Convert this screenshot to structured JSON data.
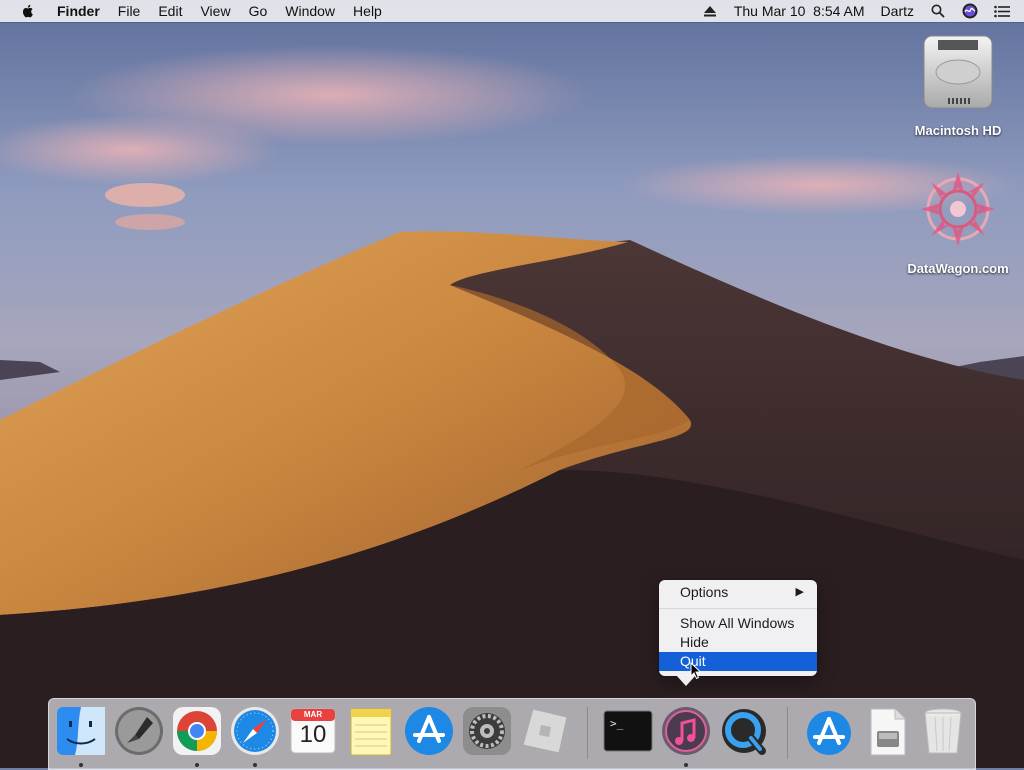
{
  "menubar": {
    "apple_icon": "apple-logo",
    "app_name": "Finder",
    "menus": [
      "File",
      "Edit",
      "View",
      "Go",
      "Window",
      "Help"
    ],
    "status": {
      "eject_icon": "eject-icon",
      "datetime": "Thu Mar 10  8:54 AM",
      "user": "Dartz",
      "search_icon": "spotlight-icon",
      "siri_icon": "siri-icon",
      "notifications_icon": "notification-center-icon"
    }
  },
  "desktop": {
    "icons": [
      {
        "label": "Macintosh HD",
        "icon": "hard-drive-icon"
      },
      {
        "label": "DataWagon.com",
        "icon": "datawagon-logo"
      }
    ]
  },
  "context_menu": {
    "items": [
      {
        "label": "Options",
        "submenu": true
      },
      {
        "label": "Show All Windows"
      },
      {
        "label": "Hide"
      },
      {
        "label": "Quit",
        "selected": true
      }
    ],
    "submenu_arrow": "▶"
  },
  "dock": {
    "apps": [
      {
        "name": "Finder",
        "icon": "finder-icon",
        "running": true
      },
      {
        "name": "Launchpad",
        "icon": "launchpad-icon",
        "running": false
      },
      {
        "name": "Google Chrome",
        "icon": "chrome-icon",
        "running": true
      },
      {
        "name": "Safari",
        "icon": "safari-icon",
        "running": true
      },
      {
        "name": "Calendar",
        "icon": "calendar-icon",
        "running": false,
        "month": "MAR",
        "day": "10"
      },
      {
        "name": "Notes",
        "icon": "notes-icon",
        "running": false
      },
      {
        "name": "App Store",
        "icon": "app-store-icon",
        "running": false
      },
      {
        "name": "System Preferences",
        "icon": "system-preferences-icon",
        "running": false
      },
      {
        "name": "Roblox",
        "icon": "roblox-icon",
        "running": false
      },
      {
        "name": "Terminal",
        "icon": "terminal-icon",
        "running": false,
        "prompt": ">_"
      },
      {
        "name": "iTunes",
        "icon": "itunes-icon",
        "running": true
      },
      {
        "name": "QuickTime Player",
        "icon": "quicktime-icon",
        "running": false
      },
      {
        "name": "App Store Downloads",
        "icon": "downloads-appstore-icon",
        "running": false
      },
      {
        "name": "Disk Image",
        "icon": "disk-image-icon",
        "running": false
      },
      {
        "name": "Trash",
        "icon": "trash-icon",
        "running": false
      }
    ]
  },
  "colors": {
    "menu_selection": "#1460d8",
    "menubar_bg": "#ececf0",
    "dune_light": "#d89a4c",
    "dune_shadow": "#3a2a2a"
  }
}
